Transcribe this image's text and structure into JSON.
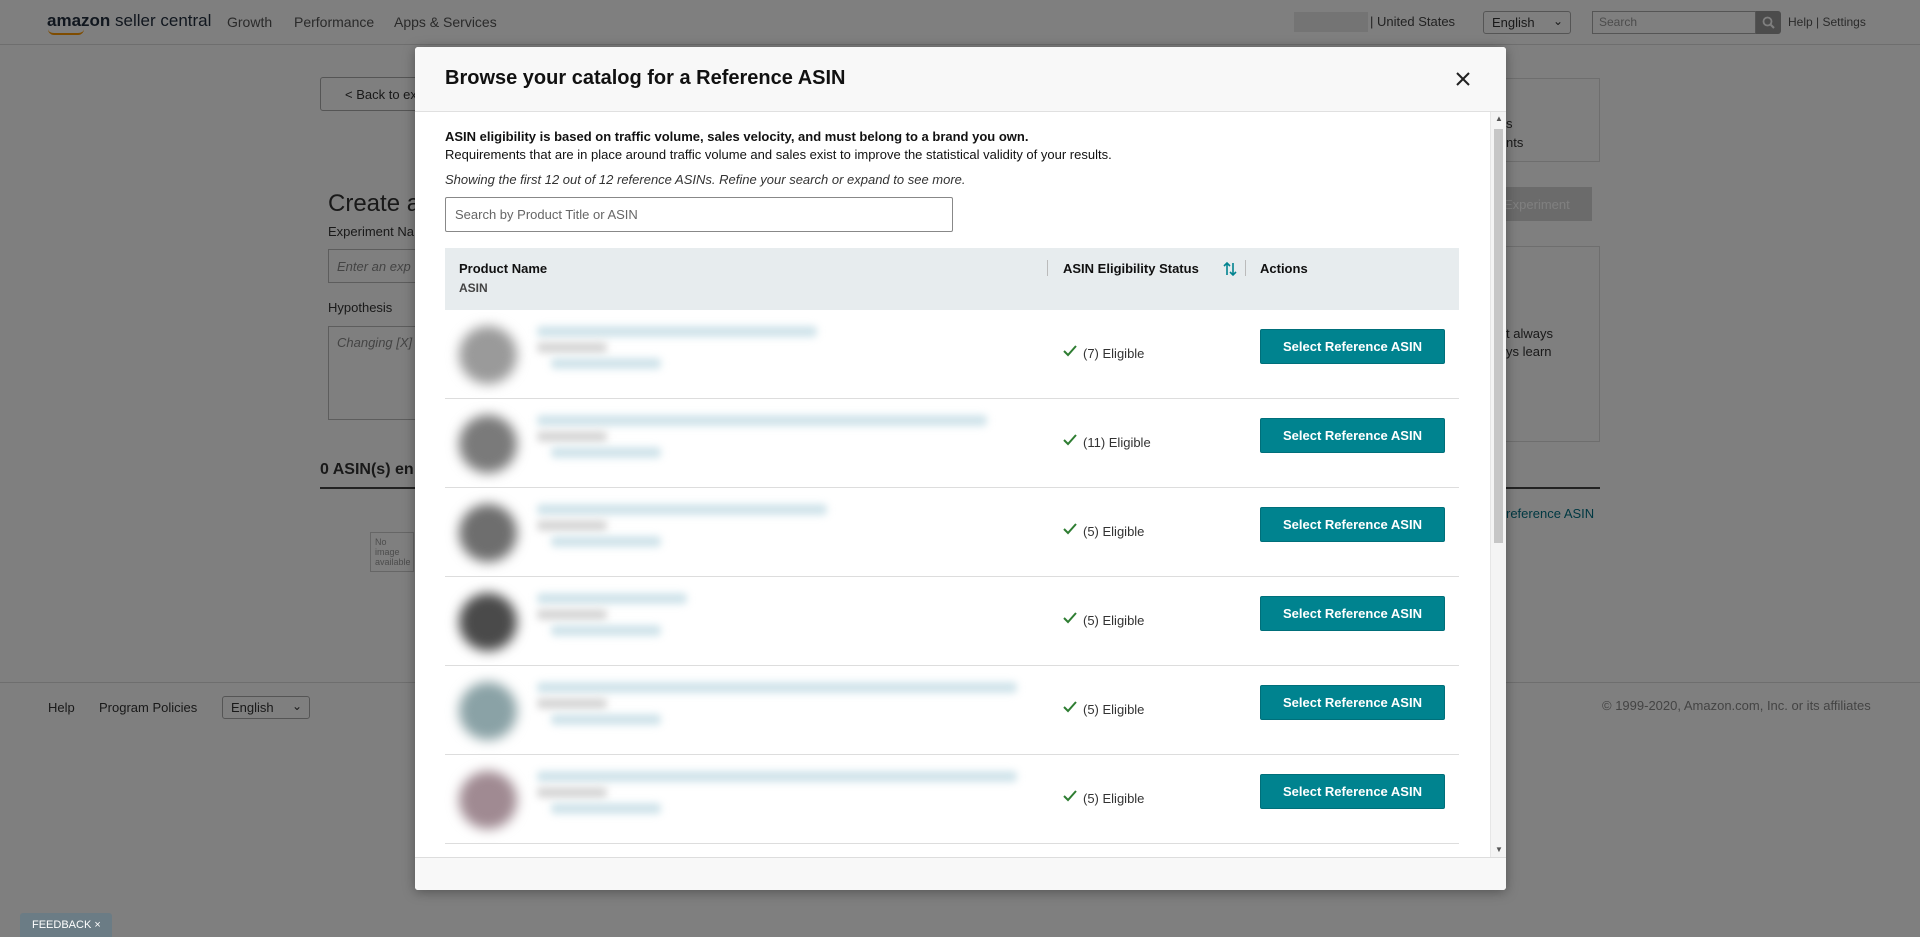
{
  "app": {
    "logo_amazon": "amazon",
    "logo_rest": "seller central",
    "nav": [
      "Growth",
      "Performance",
      "Apps & Services"
    ],
    "region": "United States",
    "language": "English",
    "search_placeholder": "Search",
    "help": "Help",
    "settings": "Settings"
  },
  "background": {
    "back_label": "< Back to ex",
    "title": "Create a",
    "experiment_name_label": "Experiment Na",
    "experiment_name_placeholder": "Enter an exp",
    "hypothesis_label": "Hypothesis",
    "hypothesis_placeholder": "Changing [X]",
    "asin_count": "0 ASIN(s) en",
    "no_image": "No image available",
    "side_line1": "s",
    "side_line2": "nts",
    "create_experiment": "Experiment",
    "side_line3": "t always",
    "side_line4": "ys learn",
    "reference_asin_link": "reference ASIN"
  },
  "footer": {
    "help": "Help",
    "program_policies": "Program Policies",
    "language": "English",
    "copyright": "© 1999-2020, Amazon.com, Inc. or its affiliates",
    "feedback": "FEEDBACK"
  },
  "modal": {
    "title": "Browse your catalog for a Reference ASIN",
    "eligibility_strong": "ASIN eligibility is based on traffic volume, sales velocity, and must belong to a brand you own.",
    "eligibility_text": "Requirements that are in place around traffic volume and sales exist to improve the statistical validity of your results.",
    "showing_text": "Showing the first 12 out of 12 reference ASINs. Refine your search or expand to see more.",
    "search_placeholder": "Search by Product Title or ASIN",
    "columns": {
      "product_name": "Product Name",
      "asin": "ASIN",
      "eligibility": "ASIN Eligibility Status",
      "actions": "Actions"
    },
    "rows": [
      {
        "status": "(7) Eligible",
        "action": "Select Reference ASIN"
      },
      {
        "status": "(11) Eligible",
        "action": "Select Reference ASIN"
      },
      {
        "status": "(5) Eligible",
        "action": "Select Reference ASIN"
      },
      {
        "status": "(5) Eligible",
        "action": "Select Reference ASIN"
      },
      {
        "status": "(5) Eligible",
        "action": "Select Reference ASIN"
      },
      {
        "status": "(5) Eligible",
        "action": "Select Reference ASIN"
      }
    ]
  },
  "colors": {
    "primary_button": "#00838f",
    "eligible_check": "#2e7d32",
    "overlay": "rgba(0,0,0,0.5)"
  }
}
